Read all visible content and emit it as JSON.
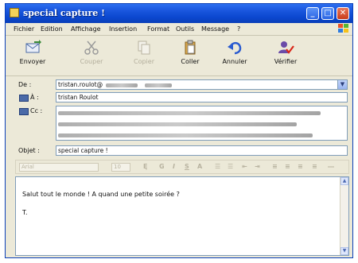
{
  "window": {
    "title": "special capture !"
  },
  "menu": [
    "Fichier",
    "Edition",
    "Affichage",
    "Insertion",
    "Format",
    "Outils",
    "Message",
    "?"
  ],
  "toolbar": {
    "send": "Envoyer",
    "cut": "Couper",
    "copy": "Copier",
    "paste": "Coller",
    "undo": "Annuler",
    "check": "Vérifier"
  },
  "header": {
    "from_label": "De :",
    "from_value": "tristan.roulot@",
    "to_label": "À :",
    "to_value": "tristan Roulot",
    "cc_label": "Cc :",
    "subject_label": "Objet :",
    "subject_value": "special capture !"
  },
  "format": {
    "font": "Arial",
    "size": "10"
  },
  "message": {
    "line1": "Salut tout le monde ! A quand une petite soirée ?",
    "line2": "T."
  },
  "colors": {
    "titlebar": "#0a3fb8",
    "chrome": "#ece9d8",
    "field_border": "#7f9db9"
  }
}
